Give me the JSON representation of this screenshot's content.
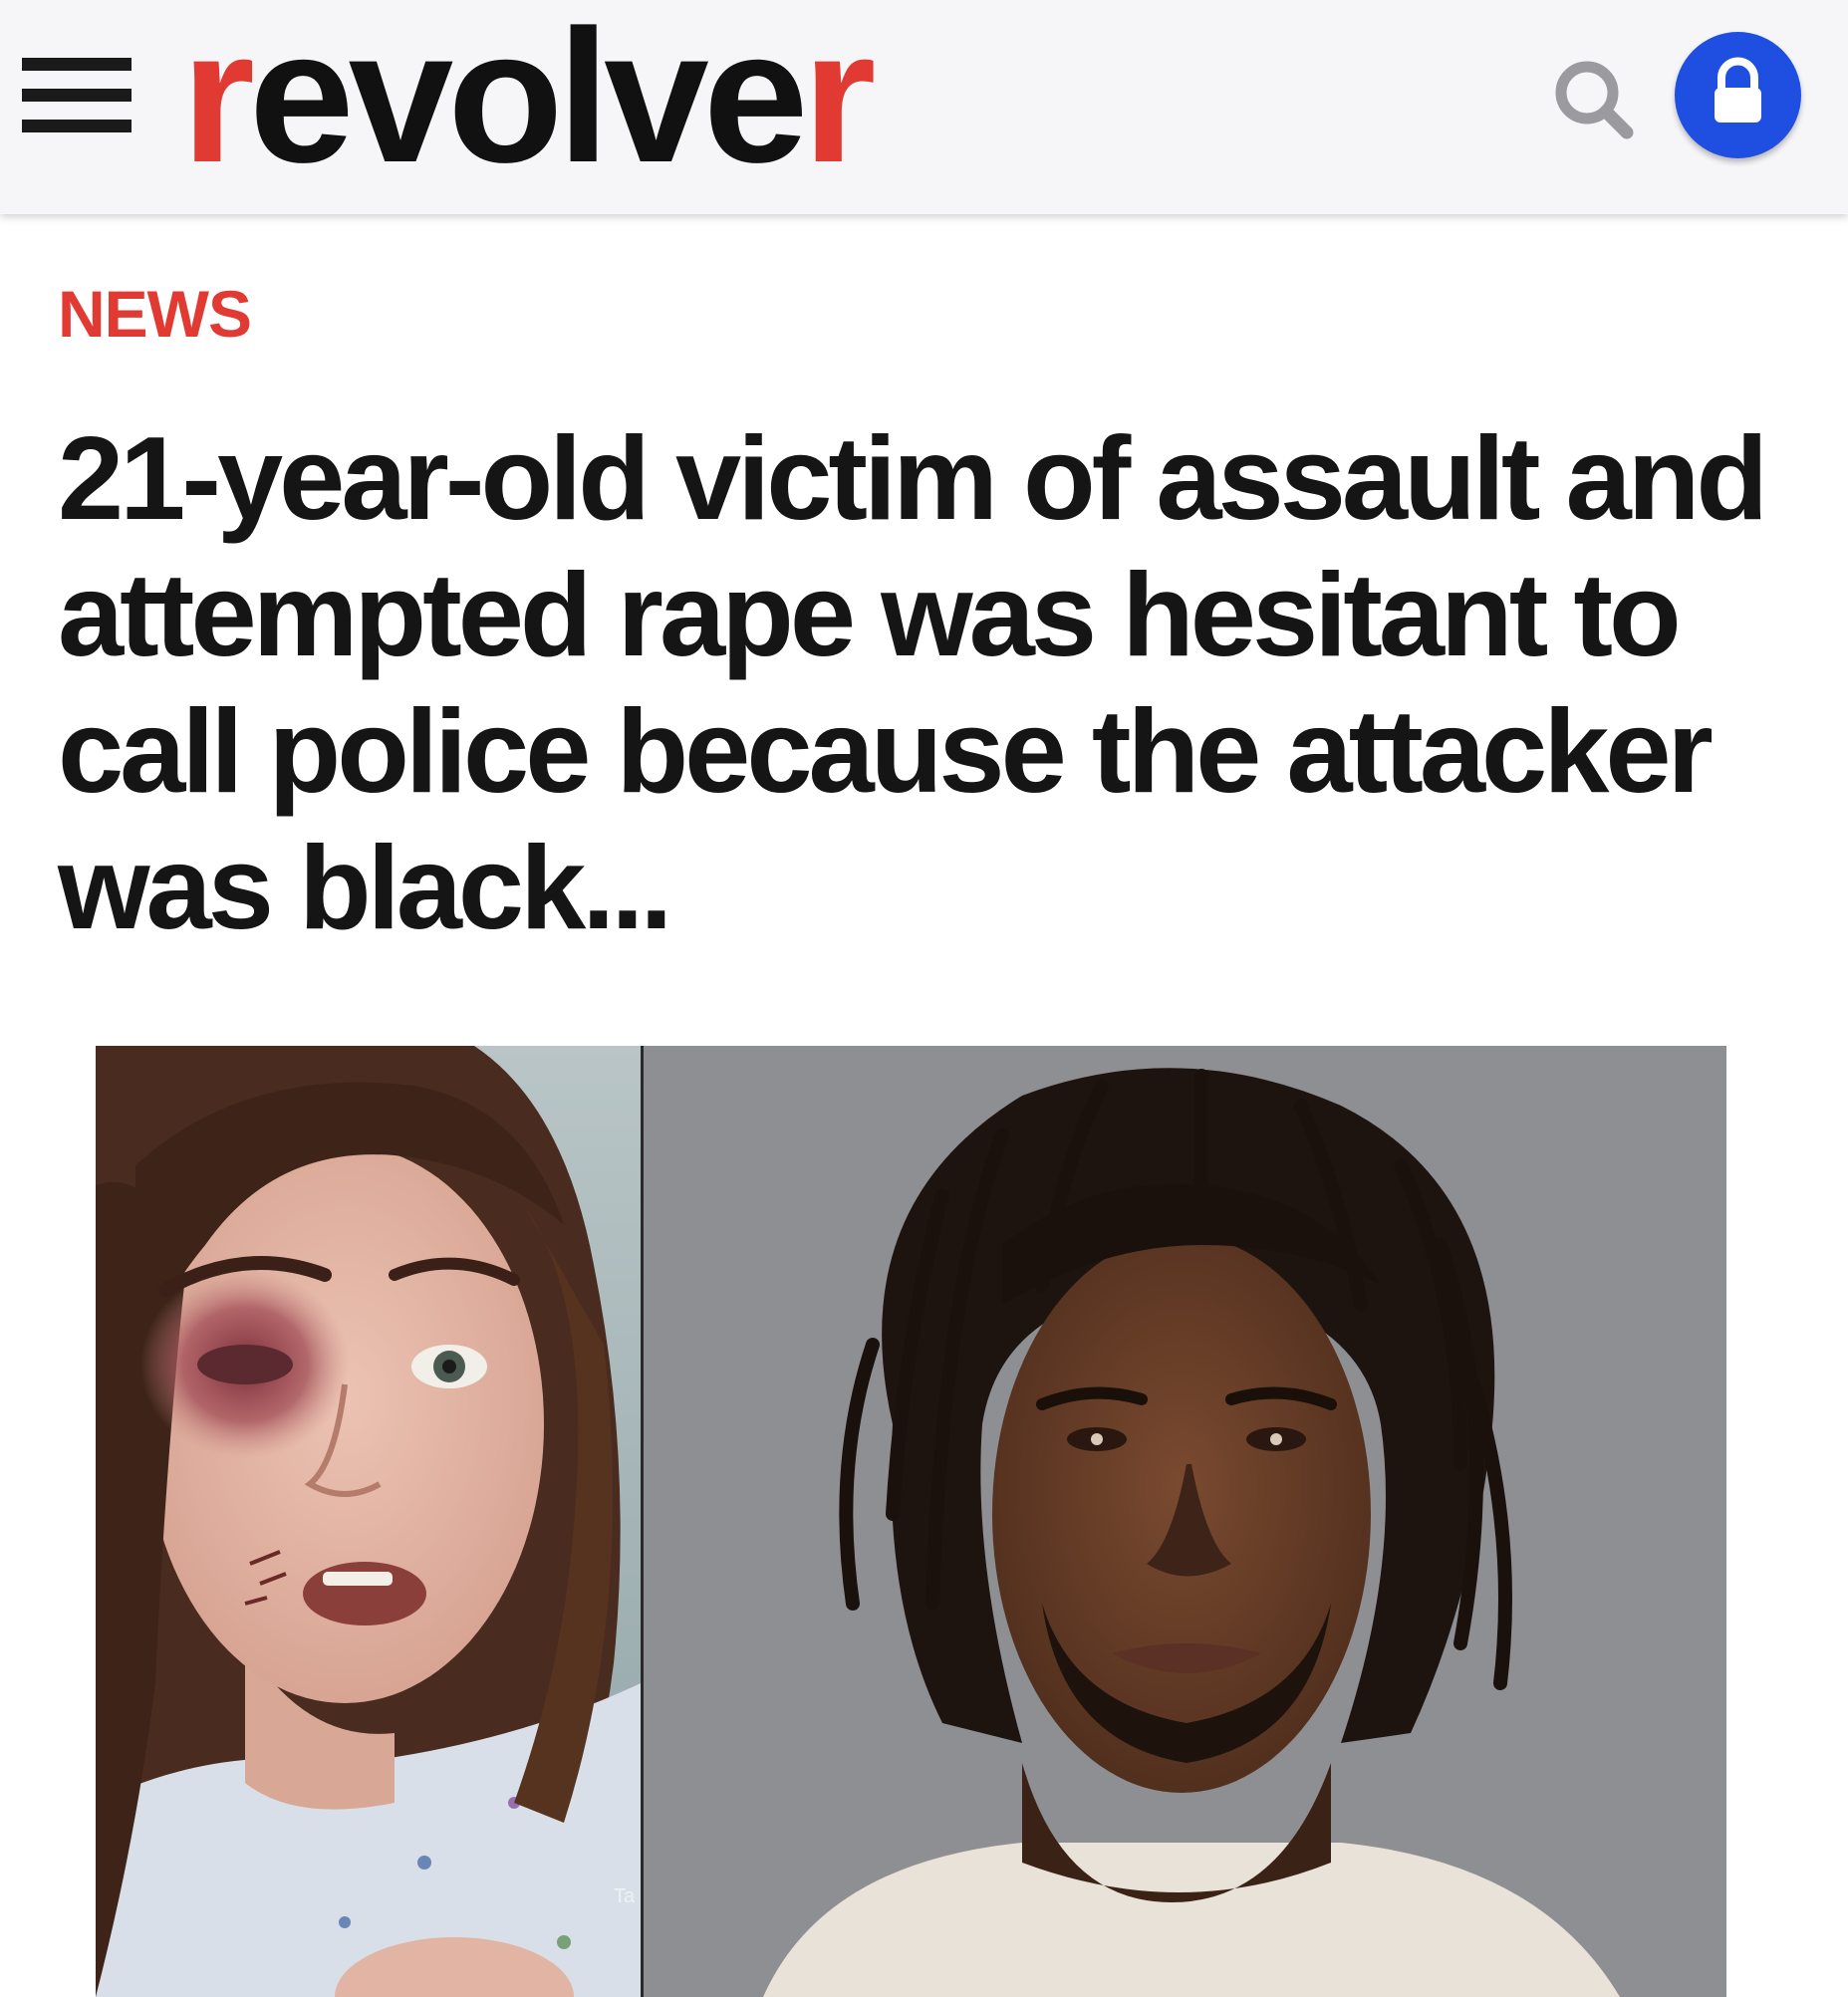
{
  "header": {
    "logo_main": "revolve",
    "logo_accent_r": "r",
    "brand_red": "#e03a33",
    "lock_blue": "#1f4fe0",
    "menu_icon": "hamburger-menu-icon",
    "search_icon": "search-icon",
    "lock_icon": "lock-icon"
  },
  "article": {
    "category": "NEWS",
    "headline": "21-year-old victim of assault and attempted rape was hesitant to call police because the attacker was black..."
  },
  "image": {
    "left_overlay_text": "Ta"
  }
}
